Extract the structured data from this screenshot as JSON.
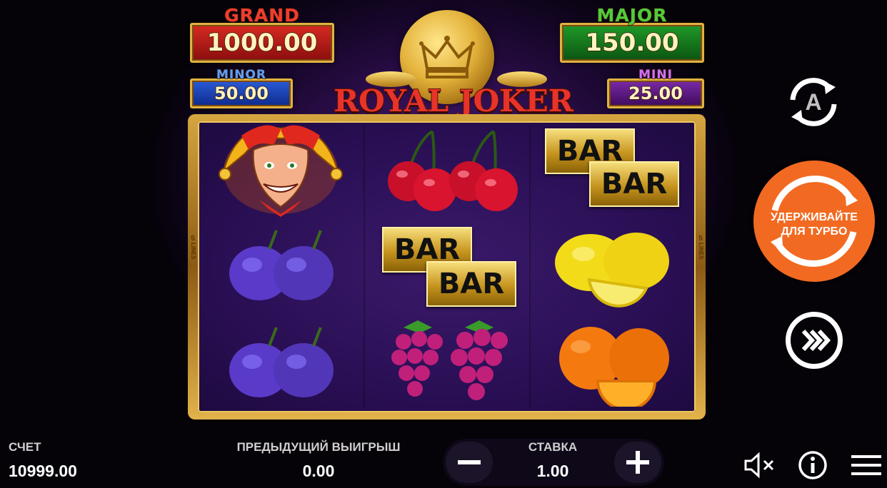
{
  "game": {
    "title_word1": "ROYAL",
    "title_word2": "JOKER"
  },
  "jackpots": {
    "grand": {
      "label": "GRAND",
      "value": "1000.00"
    },
    "major": {
      "label": "MAJOR",
      "value": "150.00"
    },
    "minor": {
      "label": "MINOR",
      "value": "50.00"
    },
    "mini": {
      "label": "MINI",
      "value": "25.00"
    }
  },
  "side_lines": {
    "count": "5",
    "word": "LINES"
  },
  "reels": [
    [
      "joker",
      "plum",
      "plum"
    ],
    [
      "cherry",
      "bar",
      "grapes"
    ],
    [
      "bar",
      "lemon",
      "orange"
    ]
  ],
  "bar_text": "BAR",
  "autoplay": {
    "letter": "A"
  },
  "spin": {
    "line1": "УДЕРЖИВАЙТЕ",
    "line2": "ДЛЯ ТУРБО"
  },
  "bottom": {
    "balance_label": "СЧЕТ",
    "balance_value": "10999.00",
    "last_win_label": "ПРЕДЫДУЩИЙ ВЫИГРЫШ",
    "last_win_value": "0.00",
    "bet_label": "СТАВКА",
    "bet_value": "1.00"
  },
  "icons": {
    "autoplay": "autoplay-icon",
    "spin": "spin-icon",
    "turbo": "fast-forward-icon",
    "minus": "minus-icon",
    "plus": "plus-icon",
    "sound": "speaker-muted-icon",
    "info": "info-icon",
    "menu": "hamburger-menu-icon"
  },
  "colors": {
    "spin": "#f26a21",
    "grand": "#c41d1d",
    "major": "#1a7a1f",
    "minor": "#1d4fc4",
    "mini": "#6a1d9a"
  }
}
